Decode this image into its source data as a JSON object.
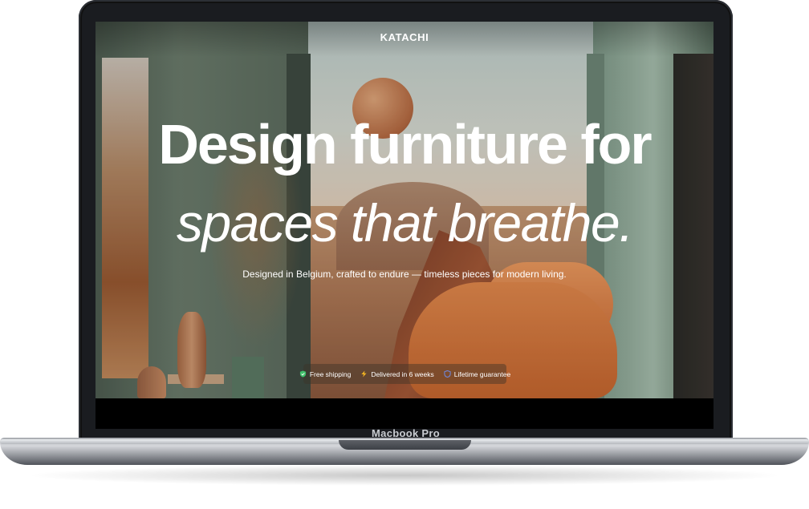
{
  "device": {
    "model_label": "Macbook Pro"
  },
  "site": {
    "brand": "KATACHI",
    "headline_line1": "Design furniture for",
    "headline_line2": "spaces that breathe.",
    "subheadline": "Designed in Belgium, crafted to endure — timeless pieces for modern living.",
    "features": [
      {
        "icon": "shield-check-icon",
        "color": "#3fbf6a",
        "label": "Free shipping"
      },
      {
        "icon": "lightning-icon",
        "color": "#f0b323",
        "label": "Delivered in 6 weeks"
      },
      {
        "icon": "shield-icon",
        "color": "#6f86d6",
        "label": "Lifetime guarantee"
      }
    ]
  }
}
